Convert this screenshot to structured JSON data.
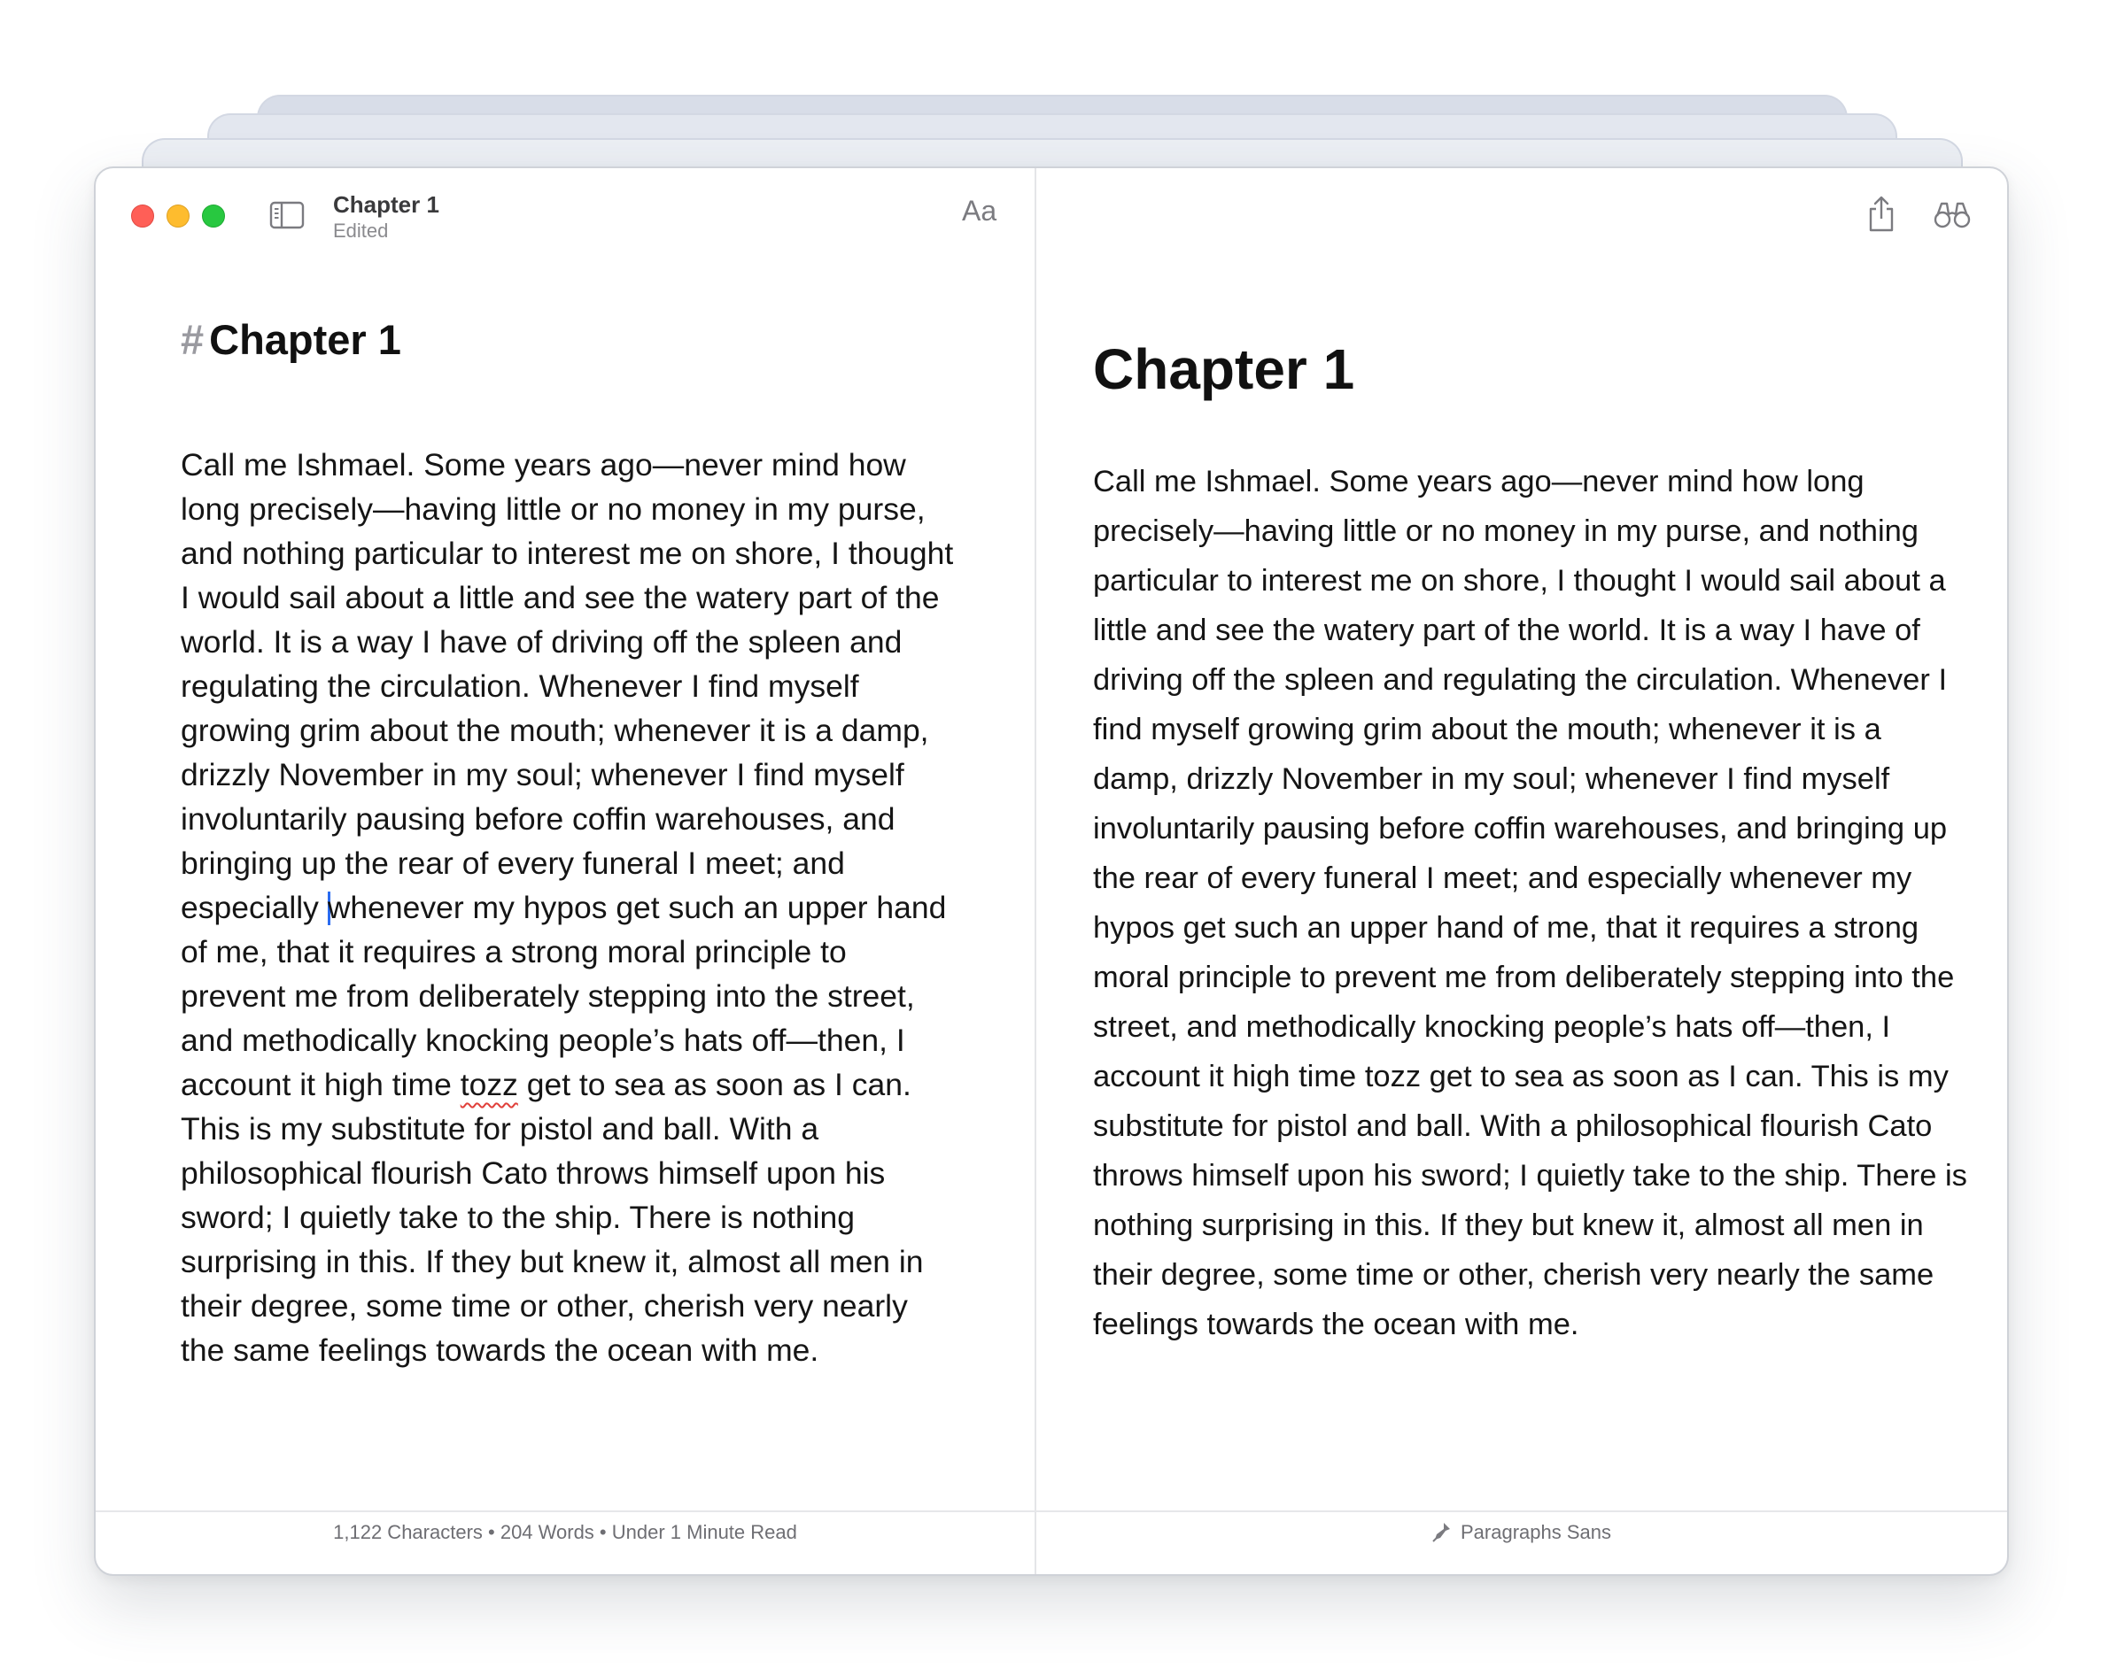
{
  "window": {
    "title": "Chapter 1",
    "status": "Edited",
    "font_button_label": "Aa"
  },
  "editor": {
    "heading_marker": "#",
    "heading": "Chapter 1",
    "body_part1": "Call me Ishmael. Some years ago—never mind how long precisely—having little or no money in my purse, and nothing particular to interest me on shore, I thought I would sail about a little and see the watery part of the world. It is a way I have of driving off the spleen and regulating the circulation. Whenever I find myself growing grim about the mouth; whenever it is a damp, drizzly November in my soul; whenever I find myself involuntarily pausing before coffin warehouses, and bringing up the rear of every funeral I meet; and especially ",
    "body_part2": "whenever my hypos get such an upper hand of me, that it requires a strong moral principle to prevent me from deliberately stepping into the street, and methodically knocking people’s hats off—then, I account it high time ",
    "misspelled_word": "tozz",
    "body_part3": " get to sea as soon as I can. This is my substitute for pistol and ball. With a philosophical flourish Cato throws himself upon his sword; I quietly take to the ship. There is nothing surprising in this. If they but knew it, almost all men in their degree, some time or other, cherish very nearly the same feelings towards the ocean with me."
  },
  "preview": {
    "heading": "Chapter 1",
    "body": "Call me Ishmael. Some years ago—never mind how long precisely—having little or no money in my purse, and nothing particular to interest me on shore, I thought I would sail about a little and see the watery part of the world. It is a way I have of driving off the spleen and regulating the circulation. Whenever I find myself growing grim about the mouth; whenever it is a damp, drizzly November in my soul; whenever I find myself involuntarily pausing before coffin warehouses, and bringing up the rear of every funeral I meet; and especially whenever my hypos get such an upper hand of me, that it requires a strong moral principle to prevent me from deliberately stepping into the street, and methodically knocking people’s hats off—then, I account it high time tozz get to sea as soon as I can. This is my substitute for pistol and ball. With a philosophical flourish Cato throws himself upon his sword; I quietly take to the ship. There is nothing surprising in this. If they but knew it, almost all men in their degree, some time or other, cherish very nearly the same feelings towards the ocean with me."
  },
  "footer": {
    "stats": "1,122 Characters • 204 Words • Under 1 Minute Read",
    "font_name": "Paragraphs Sans"
  },
  "icons": {
    "sidebar": "sidebar-icon",
    "share": "share-icon",
    "find": "binoculars-icon",
    "font": "pen-nib-icon"
  },
  "colors": {
    "close": "#ff5f57",
    "minimize": "#febc2e",
    "maximize": "#28c840",
    "caret": "#2a6cf0",
    "spellcheck": "#e0403a"
  }
}
